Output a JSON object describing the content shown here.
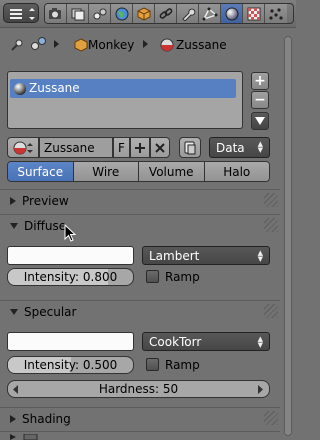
{
  "header": {
    "context_tabs": [
      {
        "icon": "render-icon"
      },
      {
        "icon": "render-layers-icon"
      },
      {
        "icon": "scene-icon"
      },
      {
        "icon": "world-icon"
      },
      {
        "icon": "object-icon"
      },
      {
        "icon": "constraints-icon"
      },
      {
        "icon": "modifiers-icon"
      },
      {
        "icon": "object-data-icon"
      },
      {
        "icon": "material-icon",
        "active": true
      },
      {
        "icon": "texture-icon"
      },
      {
        "icon": "particles-icon"
      }
    ]
  },
  "breadcrumb": {
    "object": "Monkey",
    "material": "Zussane"
  },
  "material_slots": {
    "items": [
      "Zussane"
    ],
    "add_label": "+",
    "remove_label": "−"
  },
  "datablock": {
    "name": "Zussane",
    "fake_user_label": "F",
    "link": "Data"
  },
  "tabs": [
    {
      "label": "Surface",
      "active": true
    },
    {
      "label": "Wire"
    },
    {
      "label": "Volume"
    },
    {
      "label": "Halo"
    }
  ],
  "panels": {
    "preview": {
      "title": "Preview"
    },
    "diffuse": {
      "title": "Diffuse",
      "shader": "Lambert",
      "intensity_label": "Intensity: 0.800",
      "intensity_value": 0.8,
      "ramp_label": "Ramp"
    },
    "specular": {
      "title": "Specular",
      "shader": "CookTorr",
      "intensity_label": "Intensity: 0.500",
      "intensity_value": 0.5,
      "ramp_label": "Ramp",
      "hardness_label": "Hardness: 50"
    },
    "shading": {
      "title": "Shading"
    }
  },
  "colors": {
    "accent": "#5680c2",
    "background": "#727272",
    "swatch": "#fbfbfb"
  }
}
